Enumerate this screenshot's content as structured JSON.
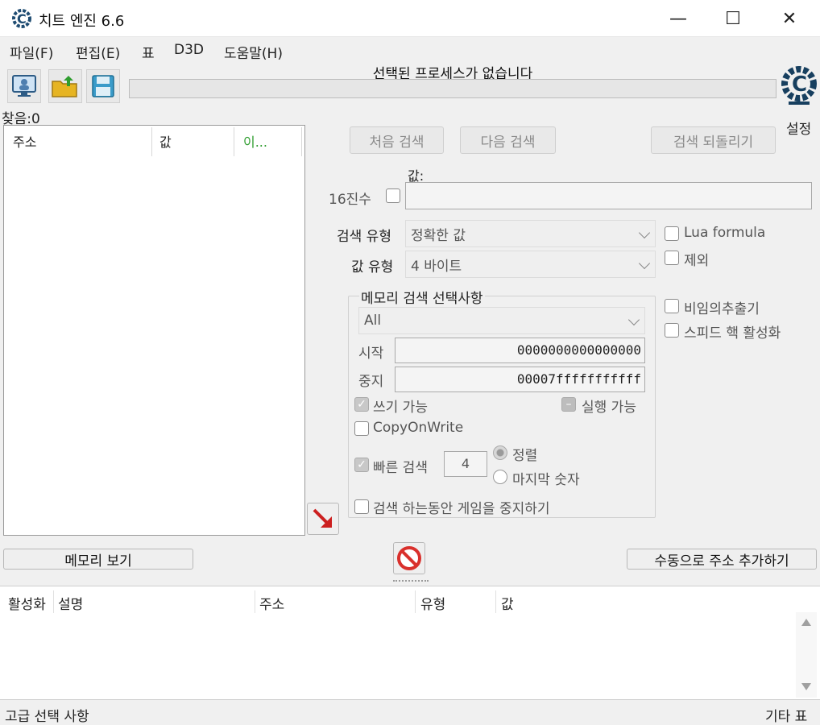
{
  "window": {
    "title": "치트 엔진 6.6",
    "minimize": "—",
    "maximize": "☐",
    "close": "✕"
  },
  "menu": [
    "파일(F)",
    "편집(E)",
    "표",
    "D3D",
    "도움말(H)"
  ],
  "toolbar": {
    "process_label": "선택된 프로세스가 없습니다",
    "settings_label": "설정",
    "open_process_icon": "monitor-icon",
    "open_file_icon": "folder-open-icon",
    "save_icon": "floppy-disk-icon"
  },
  "results": {
    "found_label": "찾음:0",
    "columns": [
      "주소",
      "값",
      "이..."
    ]
  },
  "scan": {
    "first_scan": "처음 검색",
    "next_scan": "다음 검색",
    "undo_scan": "검색 되돌리기",
    "value_label": "값:",
    "hex_label": "16진수",
    "scan_type_label": "검색 유형",
    "scan_type_value": "정확한 값",
    "value_type_label": "값 유형",
    "value_type_value": "4 바이트",
    "lua_formula": "Lua formula",
    "not": "제외",
    "unrandomizer": "비임의추출기",
    "speedhack": "스피드 핵 활성화"
  },
  "memory_options": {
    "title": "메모리 검색 선택사항",
    "region": "All",
    "start_label": "시작",
    "start_value": "0000000000000000",
    "stop_label": "중지",
    "stop_value": "00007fffffffffff",
    "writable": "쓰기 가능",
    "executable": "실행 가능",
    "copy_on_write": "CopyOnWrite",
    "fast_scan": "빠른 검색",
    "fast_scan_value": "4",
    "alignment": "정렬",
    "last_digits": "마지막 숫자",
    "pause_game": "검색 하는동안 게임을 중지하기"
  },
  "bottom": {
    "memory_view": "메모리 보기",
    "add_address": "수동으로 주소 추가하기",
    "columns": [
      "활성화",
      "설명",
      "주소",
      "유형",
      "값"
    ],
    "advanced": "고급 선택 사항",
    "table_extras": "기타 표"
  },
  "colors": {
    "accent_green": "#2e9d2e",
    "stop_red": "#d9302c",
    "arrow_red": "#cc1f1f"
  }
}
